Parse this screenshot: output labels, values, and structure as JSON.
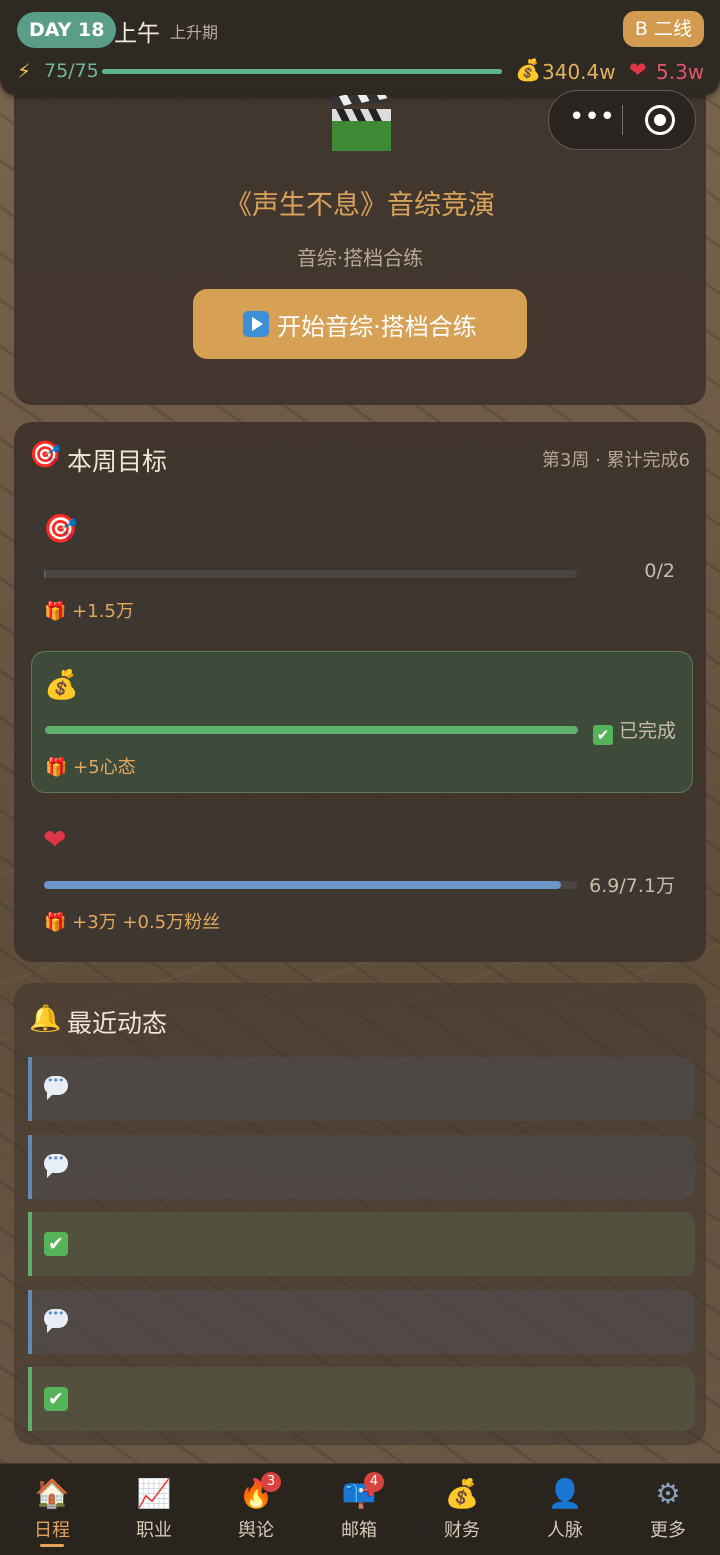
{
  "status": {
    "day": "DAY 18",
    "period": "上午",
    "phase": "上升期",
    "tier": "B 二线",
    "energy": "75/75",
    "energy_fraction": 1.0,
    "money": "340.4w",
    "fame": "5.3w"
  },
  "event": {
    "title": "《声生不息》音综竞演",
    "subtitle": "音综·搭档合练",
    "start_button": "开始音综·搭档合练"
  },
  "goals": {
    "title": "本周目标",
    "meta": "第3周 · 累计完成6",
    "items": [
      {
        "icon": "target-icon",
        "status": "0/2",
        "progress": 0.0,
        "reward": "+1.5万",
        "done": false
      },
      {
        "icon": "money-bag-icon",
        "status": "已完成",
        "progress": 1.0,
        "reward": "+5心态",
        "done": true
      },
      {
        "icon": "heart-icon",
        "status": "6.9/7.1万",
        "progress": 0.97,
        "reward": "+3万  +0.5万粉丝",
        "done": false
      }
    ]
  },
  "feed": {
    "title": "最近动态",
    "items": [
      {
        "type": "message"
      },
      {
        "type": "message"
      },
      {
        "type": "done"
      },
      {
        "type": "message"
      },
      {
        "type": "done"
      }
    ]
  },
  "tabs": [
    {
      "label": "日程",
      "icon": "home-icon",
      "active": true,
      "badge": ""
    },
    {
      "label": "职业",
      "icon": "chart-icon",
      "active": false,
      "badge": ""
    },
    {
      "label": "舆论",
      "icon": "fire-icon",
      "active": false,
      "badge": "3"
    },
    {
      "label": "邮箱",
      "icon": "mailbox-icon",
      "active": false,
      "badge": "4"
    },
    {
      "label": "财务",
      "icon": "money-bag-icon",
      "active": false,
      "badge": ""
    },
    {
      "label": "人脉",
      "icon": "person-icon",
      "active": false,
      "badge": ""
    },
    {
      "label": "更多",
      "icon": "gear-icon",
      "active": false,
      "badge": ""
    }
  ],
  "colors": {
    "accent": "#d7a155",
    "energy": "#5fb48a",
    "goal_done": "#5fb06a",
    "goal_progress": "#6b97c9",
    "fame": "#e03545"
  }
}
